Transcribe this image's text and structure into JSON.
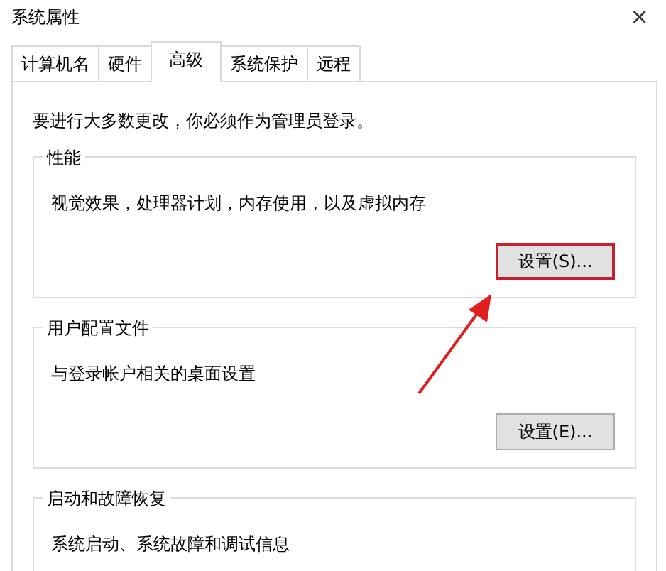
{
  "window": {
    "title": "系统属性",
    "close": "×"
  },
  "tabs": [
    {
      "label": "计算机名",
      "selected": false
    },
    {
      "label": "硬件",
      "selected": false
    },
    {
      "label": "高级",
      "selected": true
    },
    {
      "label": "系统保护",
      "selected": false
    },
    {
      "label": "远程",
      "selected": false
    }
  ],
  "notice": "要进行大多数更改，你必须作为管理员登录。",
  "groups": [
    {
      "title": "性能",
      "description": "视觉效果，处理器计划，内存使用，以及虚拟内存",
      "button": {
        "label": "设置(S)...",
        "highlighted": true
      }
    },
    {
      "title": "用户配置文件",
      "description": "与登录帐户相关的桌面设置",
      "button": {
        "label": "设置(E)...",
        "highlighted": false
      }
    },
    {
      "title": "启动和故障恢复",
      "description": "系统启动、系统故障和调试信息"
    }
  ]
}
